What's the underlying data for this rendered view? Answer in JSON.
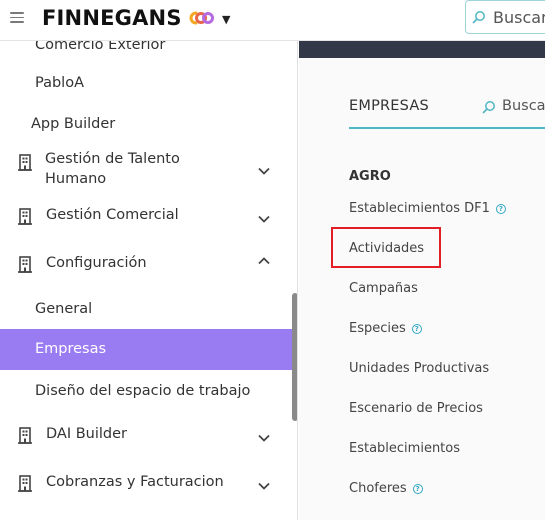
{
  "header": {
    "brand": "FINNEGANS",
    "logo_colors": [
      "#f5a623",
      "#b46be0"
    ],
    "search_placeholder": "Buscar"
  },
  "sidebar": {
    "items": [
      {
        "label": "Comercio Exterior",
        "type": "sub"
      },
      {
        "label": "PabloA",
        "type": "sub"
      },
      {
        "label": "App Builder",
        "type": "sub"
      },
      {
        "label_line1": "Gestión de Talento",
        "label_line2": "Humano",
        "type": "group",
        "expanded": false
      },
      {
        "label": "Gestión Comercial",
        "type": "group",
        "expanded": false
      },
      {
        "label": "Configuración",
        "type": "group",
        "expanded": true
      },
      {
        "label": "General",
        "type": "sub"
      },
      {
        "label": "Empresas",
        "type": "sub",
        "active": true
      },
      {
        "label": "Diseño del espacio de trabajo",
        "type": "sub"
      },
      {
        "label": "DAI Builder",
        "type": "group",
        "expanded": false
      },
      {
        "label": "Cobranzas y Facturacion",
        "type": "group",
        "expanded": false
      }
    ],
    "active_color": "#9a7cf2"
  },
  "main": {
    "tab": "EMPRESAS",
    "search_placeholder": "Buscar",
    "section": "AGRO",
    "items": [
      {
        "label": "Establecimientos DF1",
        "help": true
      },
      {
        "label": "Actividades",
        "help": false,
        "highlighted": true
      },
      {
        "label": "Campañas",
        "help": false
      },
      {
        "label": "Especies",
        "help": true
      },
      {
        "label": "Unidades Productivas",
        "help": false
      },
      {
        "label": "Escenario de Precios",
        "help": false
      },
      {
        "label": "Establecimientos",
        "help": false
      },
      {
        "label": "Choferes",
        "help": true
      }
    ],
    "accent_color": "#4fb7c3",
    "highlight_color": "#e41e26"
  }
}
